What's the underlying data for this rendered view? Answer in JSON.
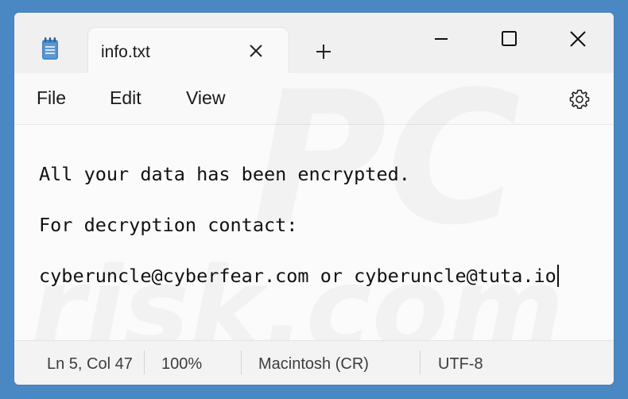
{
  "tab": {
    "title": "info.txt"
  },
  "menu": {
    "file": "File",
    "edit": "Edit",
    "view": "View"
  },
  "editor": {
    "lines": [
      "All your data has been encrypted.",
      "For decryption contact:",
      "cyberuncle@cyberfear.com or cyberuncle@tuta.io"
    ]
  },
  "status": {
    "position": "Ln 5, Col 47",
    "zoom": "100%",
    "line_ending": "Macintosh (CR)",
    "encoding": "UTF-8"
  },
  "watermark": {
    "top": "PC",
    "bottom": "risk.com"
  },
  "colors": {
    "background": "#4a88c4",
    "window": "#f9f9f9",
    "accent_icon": "#4a86c5"
  },
  "icons": [
    "notepad-icon",
    "close-tab-icon",
    "add-tab-icon",
    "minimize-icon",
    "maximize-icon",
    "close-window-icon",
    "settings-gear-icon"
  ]
}
